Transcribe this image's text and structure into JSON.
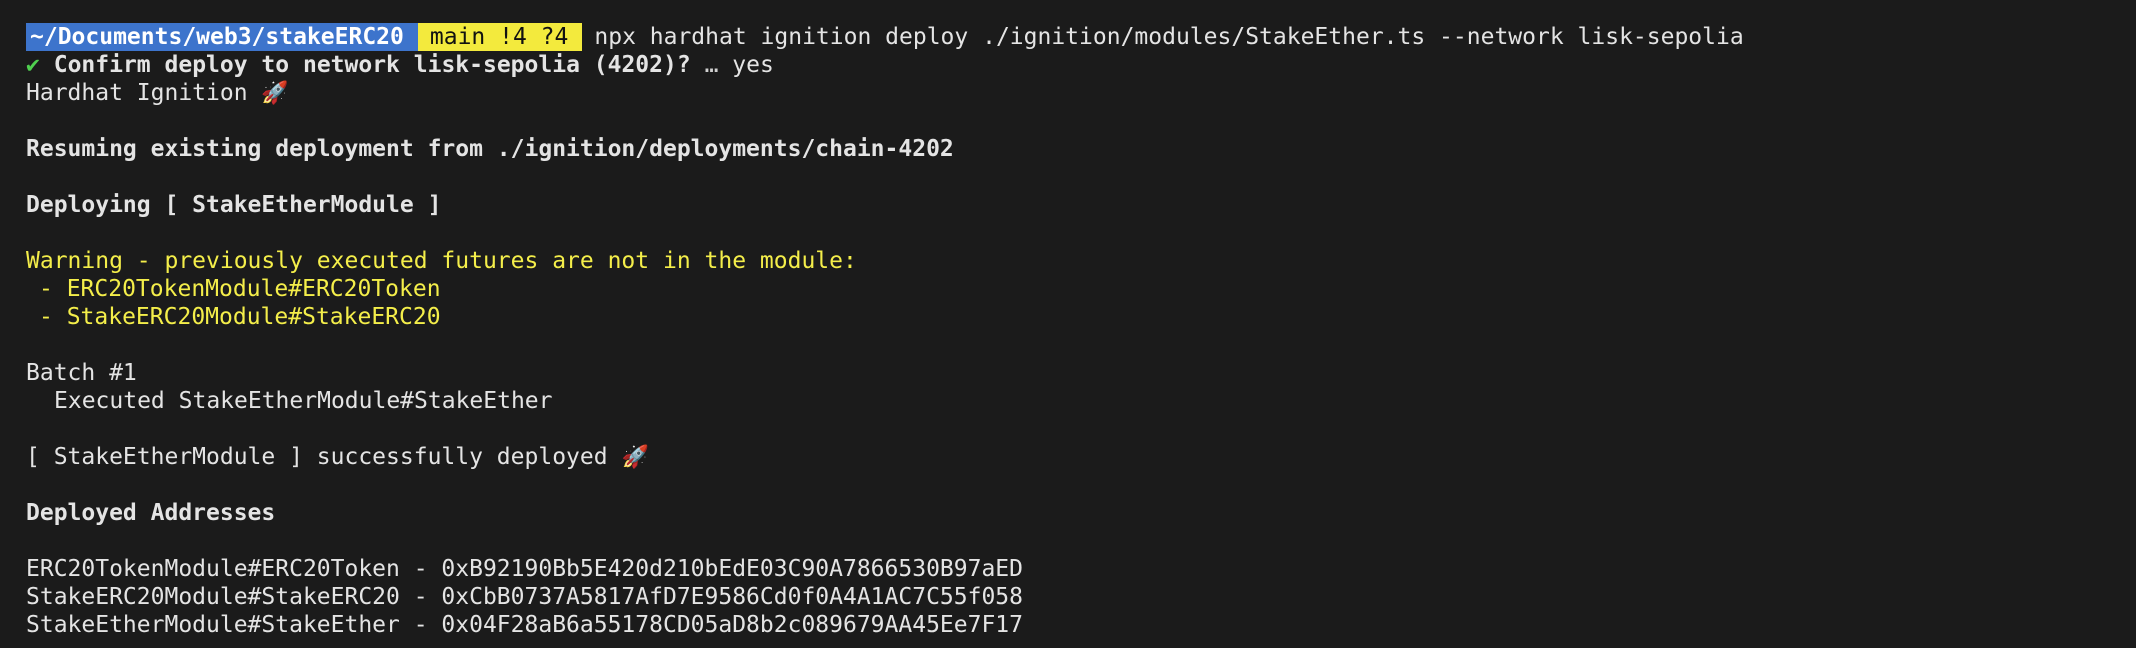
{
  "prompt": {
    "path_prefix": "~/Documents/",
    "path_bold": "web3/stakeERC20",
    "git_status": "main !4 ?4",
    "command": "npx hardhat ignition deploy ./ignition/modules/StakeEther.ts --network lisk-sepolia"
  },
  "confirm": {
    "check": "✔",
    "question": "Confirm deploy to network lisk-sepolia (4202)?",
    "ellipsis": "…",
    "answer": "yes"
  },
  "header": {
    "title": "Hardhat Ignition",
    "emoji": "🚀"
  },
  "resuming": "Resuming existing deployment from ./ignition/deployments/chain-4202",
  "deploying": "Deploying [ StakeEtherModule ]",
  "warning": {
    "title": "Warning - previously executed futures are not in the module:",
    "items": [
      "- ERC20TokenModule#ERC20Token",
      "- StakeERC20Module#StakeERC20"
    ]
  },
  "batch": {
    "title": "Batch #1",
    "executed": "Executed StakeEtherModule#StakeEther"
  },
  "success": {
    "text": "[ StakeEtherModule ] successfully deployed",
    "emoji": "🚀"
  },
  "addresses": {
    "title": "Deployed Addresses",
    "items": [
      "ERC20TokenModule#ERC20Token - 0xB92190Bb5E420d210bEdE03C90A7866530B97aED",
      "StakeERC20Module#StakeERC20 - 0xCbB0737A5817AfD7E9586Cd0f0A4A1AC7C55f058",
      "StakeEtherModule#StakeEther - 0x04F28aB6a55178CD05aD8b2c089679AA45Ee7F17"
    ]
  },
  "colors": {
    "background": "#1b1b1b",
    "foreground": "#e4e4e4",
    "path_segment": "#3d74cc",
    "git_segment": "#f3ea3d",
    "warning": "#f4ee4a",
    "check": "#4fd04f"
  }
}
